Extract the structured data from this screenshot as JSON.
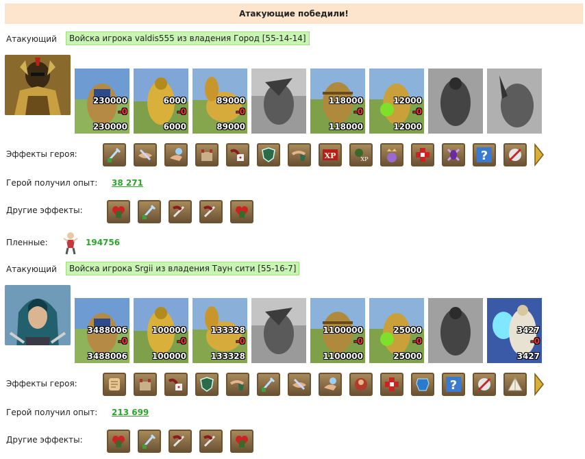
{
  "banner": "Атакующие победили!",
  "labels": {
    "attacker": "Атакующий",
    "hero_effects": "Эффекты героя:",
    "exp": "Герой получил опыт:",
    "other_effects": "Другие эффекты:",
    "prisoners": "Пленные:"
  },
  "armies": [
    {
      "title": "Войска игрока valdis555 из владения Город [55-14-14]",
      "exp": "38 271",
      "hero": "armored-knight",
      "units": [
        {
          "top": "230000",
          "loss": "-0",
          "bot": "230000",
          "theme": "tan"
        },
        {
          "top": "6000",
          "loss": "-0",
          "bot": "6000",
          "theme": "gold"
        },
        {
          "top": "89000",
          "loss": "-0",
          "bot": "89000",
          "theme": "gold"
        },
        {
          "top": "",
          "loss": "",
          "bot": "",
          "theme": "gray"
        },
        {
          "top": "118000",
          "loss": "-0",
          "bot": "118000",
          "theme": "green"
        },
        {
          "top": "12000",
          "loss": "-0",
          "bot": "12000",
          "theme": "green"
        },
        {
          "top": "",
          "loss": "",
          "bot": "",
          "theme": "gray"
        },
        {
          "top": "",
          "loss": "",
          "bot": "",
          "theme": "gray"
        }
      ],
      "hero_effects": [
        "sword",
        "handshake",
        "magic-hand",
        "fortress",
        "dice-hand",
        "shield",
        "handshake-shield",
        "xp",
        "xp-warrior",
        "crown-warrior",
        "red-cross",
        "purple-warrior",
        "question",
        "crossed-rune"
      ],
      "other_effects": [
        "heart-warrior",
        "sword",
        "sword-hand",
        "sword-hand",
        "heart-warrior"
      ],
      "prisoners": "194756"
    },
    {
      "title": "Войска игрока Srgii из владения Таун сити [55-16-7]",
      "exp": "213 699",
      "hero": "hooded-assassin",
      "units": [
        {
          "top": "3488006",
          "loss": "-0",
          "bot": "3488006",
          "theme": "tan"
        },
        {
          "top": "100000",
          "loss": "-0",
          "bot": "100000",
          "theme": "gold"
        },
        {
          "top": "133328",
          "loss": "-0",
          "bot": "133328",
          "theme": "gold"
        },
        {
          "top": "",
          "loss": "",
          "bot": "",
          "theme": "gray"
        },
        {
          "top": "1100000",
          "loss": "-0",
          "bot": "1100000",
          "theme": "green"
        },
        {
          "top": "25000",
          "loss": "-0",
          "bot": "25000",
          "theme": "green"
        },
        {
          "top": "",
          "loss": "",
          "bot": "",
          "theme": "gray"
        },
        {
          "top": "3427",
          "loss": "-0",
          "bot": "3427",
          "theme": "blue"
        }
      ],
      "hero_effects": [
        "scroll",
        "fortress",
        "dice-hand",
        "shield",
        "handshake-shield",
        "sword",
        "handshake",
        "magic-hand",
        "red-warrior",
        "red-cross",
        "blue-armor",
        "question",
        "crossed-rune",
        "tent"
      ],
      "other_effects": [
        "heart-warrior",
        "sword",
        "sword-hand",
        "sword-hand",
        "heart-warrior"
      ]
    }
  ]
}
